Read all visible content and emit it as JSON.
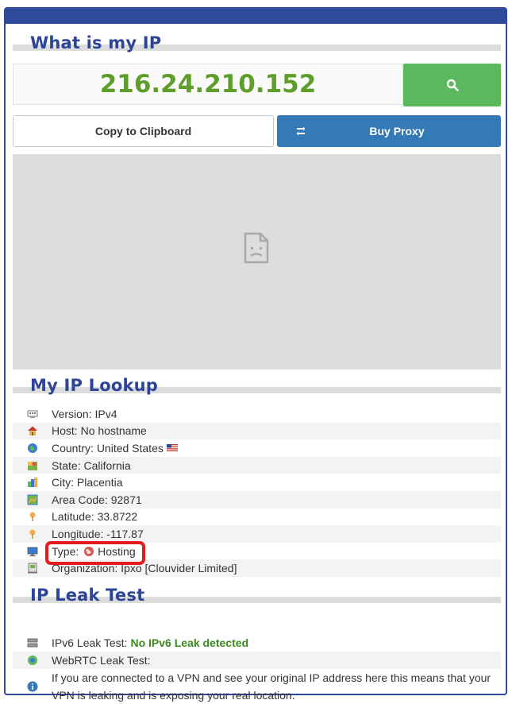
{
  "header": {
    "title": "What is my IP"
  },
  "ip": {
    "address": "216.24.210.152"
  },
  "buttons": {
    "copy_label": "Copy to Clipboard",
    "proxy_label": "Buy Proxy"
  },
  "lookup": {
    "title": "My IP Lookup",
    "rows": [
      {
        "label": "Version:",
        "value": "IPv4",
        "icon": "network-card-icon"
      },
      {
        "label": "Host:",
        "value": "No hostname",
        "icon": "house-icon"
      },
      {
        "label": "Country:",
        "value": "United States",
        "icon": "globe-icon"
      },
      {
        "label": "State:",
        "value": "California",
        "icon": "map-pin-icon"
      },
      {
        "label": "City:",
        "value": "Placentia",
        "icon": "city-buildings-icon"
      },
      {
        "label": "Area Code:",
        "value": "92871",
        "icon": "area-map-icon"
      },
      {
        "label": "Latitude:",
        "value": "33.8722",
        "icon": "pin-icon"
      },
      {
        "label": "Longitude:",
        "value": "-117.87",
        "icon": "pin-icon"
      },
      {
        "label": "Type:",
        "value": "Hosting",
        "icon": "monitor-icon"
      },
      {
        "label": "Organization:",
        "value": "Ipxo [Clouvider Limited]",
        "icon": "organization-icon"
      }
    ]
  },
  "leak": {
    "title": "IP Leak Test",
    "ipv6_label": "IPv6 Leak Test:",
    "ipv6_result": "No IPv6 Leak detected",
    "webrtc_label": "WebRTC Leak Test:",
    "vpn_note": "If you are connected to a VPN and see your original IP address here this means that your VPN is leaking and is exposing your real location."
  },
  "colors": {
    "brand": "#2c4596",
    "ip_green": "#5e9e2a",
    "search_green": "#5cb85c",
    "proxy_blue": "#337ab7",
    "highlight_red": "#e31b1b"
  }
}
